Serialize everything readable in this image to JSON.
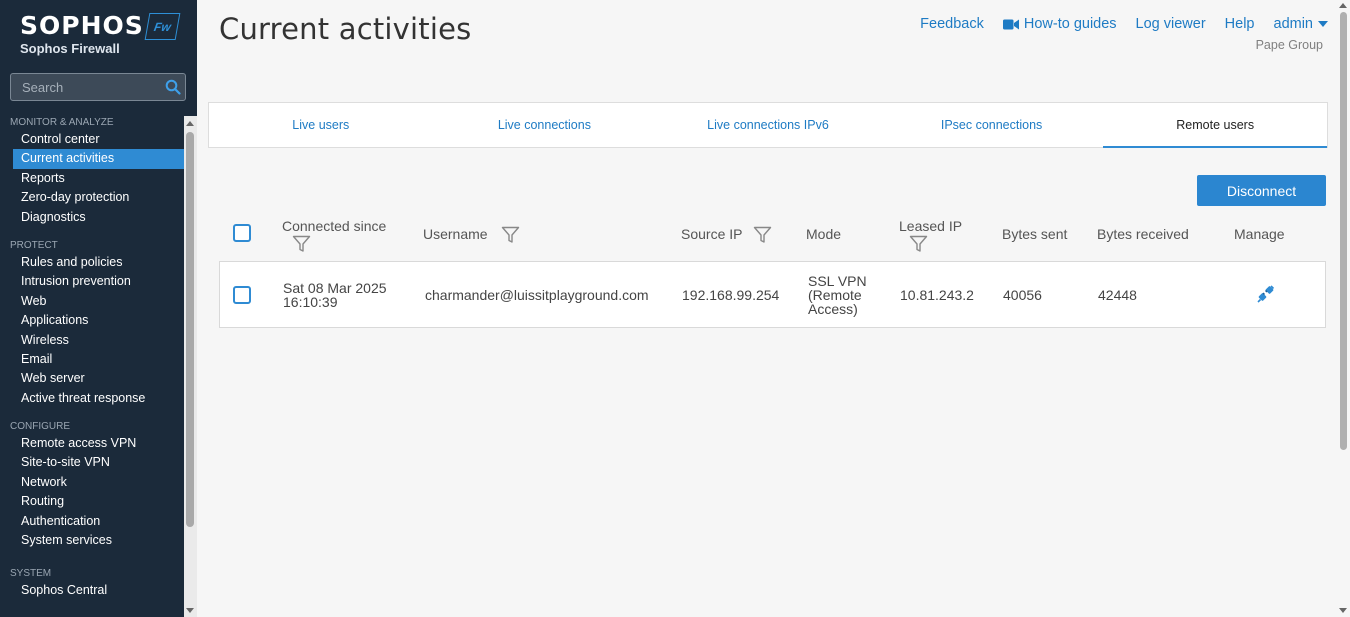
{
  "brand": {
    "name": "SOPHOS",
    "product": "Sophos Firewall",
    "badge": "Fw"
  },
  "search": {
    "placeholder": "Search"
  },
  "nav": {
    "sections": [
      {
        "title": "MONITOR & ANALYZE",
        "items": [
          "Control center",
          "Current activities",
          "Reports",
          "Zero-day protection",
          "Diagnostics"
        ]
      },
      {
        "title": "PROTECT",
        "items": [
          "Rules and policies",
          "Intrusion prevention",
          "Web",
          "Applications",
          "Wireless",
          "Email",
          "Web server",
          "Active threat response"
        ]
      },
      {
        "title": "CONFIGURE",
        "items": [
          "Remote access VPN",
          "Site-to-site VPN",
          "Network",
          "Routing",
          "Authentication",
          "System services"
        ]
      },
      {
        "title": "SYSTEM",
        "items": [
          "Sophos Central"
        ]
      }
    ],
    "active": "Current activities"
  },
  "header": {
    "title": "Current activities",
    "links": {
      "feedback": "Feedback",
      "howto": "How-to guides",
      "log": "Log viewer",
      "help": "Help",
      "user": "admin"
    },
    "org": "Pape Group"
  },
  "tabs": [
    "Live users",
    "Live connections",
    "Live connections IPv6",
    "IPsec connections",
    "Remote users"
  ],
  "active_tab": "Remote users",
  "actions": {
    "disconnect": "Disconnect"
  },
  "table": {
    "columns": {
      "connected": "Connected since",
      "username": "Username",
      "source_ip": "Source IP",
      "mode": "Mode",
      "leased_ip": "Leased IP",
      "bytes_sent": "Bytes sent",
      "bytes_received": "Bytes received",
      "manage": "Manage"
    },
    "rows": [
      {
        "connected_line1": "Sat 08 Mar 2025",
        "connected_line2": "16:10:39",
        "username": "charmander@luissitplayground.com",
        "source_ip": "192.168.99.254",
        "mode_line1": "SSL VPN",
        "mode_line2": "(Remote",
        "mode_line3": "Access)",
        "leased_ip": "10.81.243.2",
        "bytes_sent": "40056",
        "bytes_received": "42448"
      }
    ]
  },
  "colors": {
    "sidebar": "#1b2a3a",
    "accent": "#2f8bd3",
    "link": "#1e7bc4"
  }
}
